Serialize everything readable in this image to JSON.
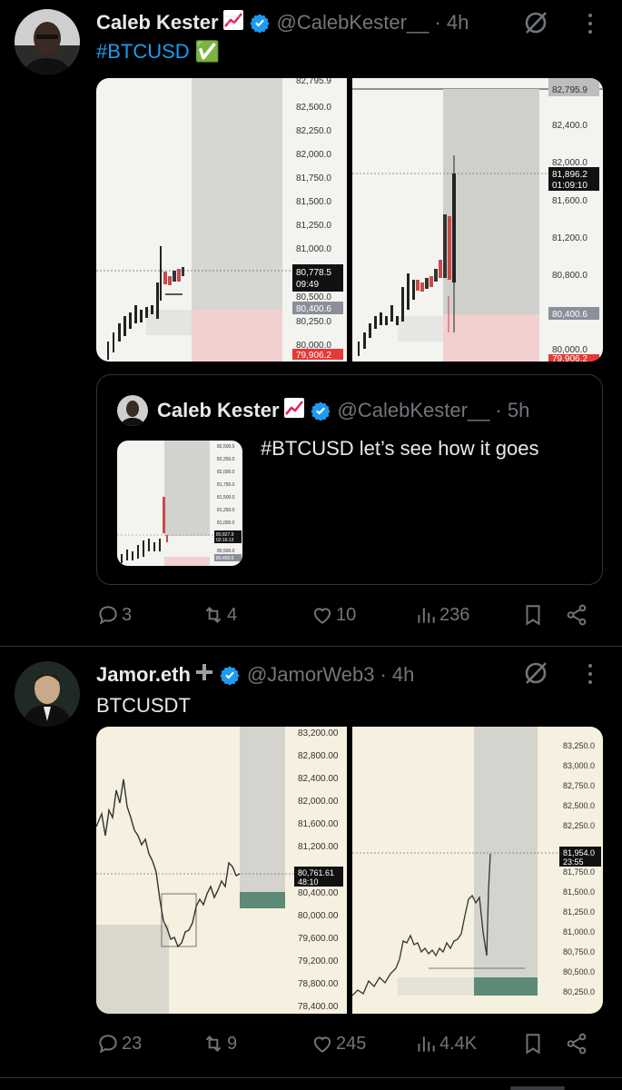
{
  "posts": [
    {
      "author_name": "Caleb Kester",
      "handle": "@CalebKester__",
      "time": "· 4h",
      "text": "#BTCUSD ✅",
      "chart_left_prices": [
        "82,795.9",
        "82,500.0",
        "82,250.0",
        "82,000.0",
        "81,750.0",
        "81,500.0",
        "81,250.0",
        "81,000.0",
        "80,778.5",
        "09:49",
        "80,500.0",
        "80,400.6",
        "80,250.0",
        "80,000.0",
        "79,906.2"
      ],
      "chart_right_prices": [
        "82,795.9",
        "82,400.0",
        "82,000.0",
        "81,896.2",
        "01:09:10",
        "81,600.0",
        "81,200.0",
        "80,800.0",
        "80,400.6",
        "80,000.0",
        "79,906.2"
      ],
      "quote": {
        "author_name": "Caleb Kester",
        "handle": "@CalebKester__",
        "time": "· 5h",
        "text": "#BTCUSD let’s see how it goes",
        "thumb_prices": [
          "82,500.0",
          "82,250.0",
          "82,000.0",
          "81,750.0",
          "81,500.0",
          "81,250.0",
          "81,000.0",
          "80,827.9",
          "02:16:13",
          "80,500.0",
          "80,400.6"
        ]
      },
      "stats": {
        "replies": "3",
        "reposts": "4",
        "likes": "10",
        "views": "236"
      }
    },
    {
      "author_name": "Jamor.eth",
      "handle": "@JamorWeb3",
      "time": "· 4h",
      "text": "BTCUSDT",
      "chart_left_prices": [
        "83,200.00",
        "82,800.00",
        "82,400.00",
        "82,000.00",
        "81,600.00",
        "81,200.00",
        "80,761.61",
        "48:10",
        "80,400.00",
        "80,000.00",
        "79,600.00",
        "79,200.00",
        "78,800.00",
        "78,400.00"
      ],
      "chart_right_prices": [
        "83,250.0",
        "83,000.0",
        "82,750.0",
        "82,500.0",
        "82,250.0",
        "81,954.0",
        "23:55",
        "81,750.0",
        "81,500.0",
        "81,250.0",
        "81,000.0",
        "80,750.0",
        "80,500.0",
        "80,250.0"
      ],
      "stats": {
        "replies": "23",
        "reposts": "9",
        "likes": "245",
        "views": "4.4K"
      }
    }
  ],
  "colors": {
    "accent": "#1d9bf0",
    "muted": "#71767b",
    "up": "#26a69a",
    "down": "#ef5350"
  }
}
